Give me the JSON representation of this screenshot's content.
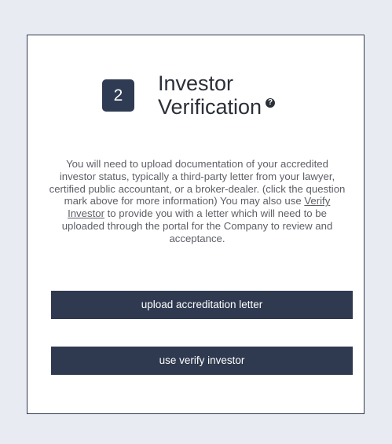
{
  "step": {
    "number": "2",
    "title_line1": "Investor",
    "title_line2": "Verification",
    "help_icon": "question-circle-icon",
    "help_glyph": "?"
  },
  "description": {
    "part1": "You will need to upload documentation of your accredited investor status, typically a third-party letter from your lawyer, certified public accountant, or a broker-dealer. (click the question mark above for more information) You may also use ",
    "link_text": "Verify Investor",
    "part2": " to provide you with a letter which will need to be uploaded through the portal for the Company to review and acceptance."
  },
  "buttons": {
    "upload_label": "upload accreditation letter",
    "verify_label": "use verify investor"
  },
  "colors": {
    "page_background": "#e8ebf2",
    "card_background": "#ffffff",
    "button_background": "#2f3a50",
    "badge_background": "#2f3b52",
    "text": "#5d5f66"
  }
}
